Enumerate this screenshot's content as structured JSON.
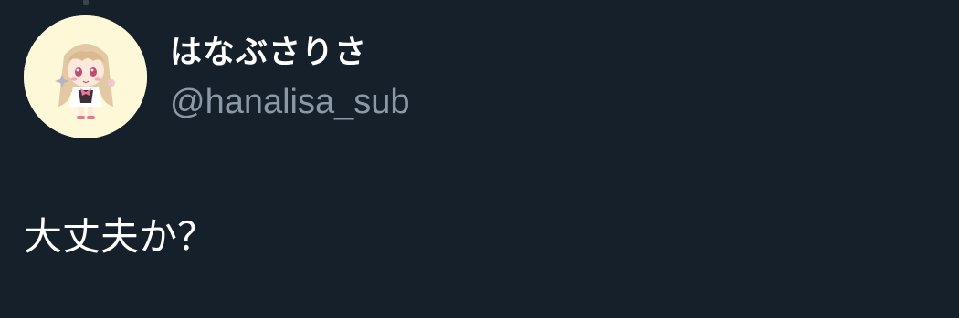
{
  "tweet": {
    "display_name": "はなぶさりさ",
    "handle": "@hanalisa_sub",
    "text": "大丈夫か？"
  },
  "colors": {
    "background": "#15202b",
    "primary_text": "#ffffff",
    "secondary_text": "#8b98a5",
    "avatar_background": "#fdf9d8"
  },
  "icons": {
    "avatar": "chibi-character-avatar"
  }
}
